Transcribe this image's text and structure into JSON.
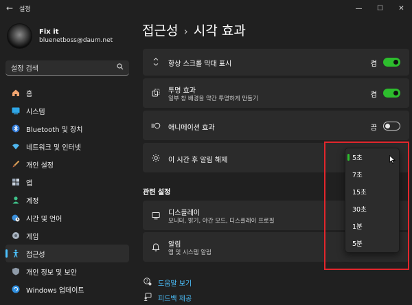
{
  "window": {
    "title": "설정"
  },
  "profile": {
    "name": "Fix it",
    "email": "bluenetboss@daum.net"
  },
  "search": {
    "placeholder": "설정 검색"
  },
  "nav": [
    {
      "label": "홈",
      "icon": "home-icon"
    },
    {
      "label": "시스템",
      "icon": "system-icon"
    },
    {
      "label": "Bluetooth 및 장치",
      "icon": "bluetooth-icon"
    },
    {
      "label": "네트워크 및 인터넷",
      "icon": "wifi-icon"
    },
    {
      "label": "개인 설정",
      "icon": "brush-icon"
    },
    {
      "label": "앱",
      "icon": "apps-icon"
    },
    {
      "label": "계정",
      "icon": "account-icon"
    },
    {
      "label": "시간 및 언어",
      "icon": "globe-clock-icon"
    },
    {
      "label": "게임",
      "icon": "gamepad-icon"
    },
    {
      "label": "접근성",
      "icon": "accessibility-icon",
      "active": true
    },
    {
      "label": "개인 정보 및 보안",
      "icon": "shield-icon"
    },
    {
      "label": "Windows 업데이트",
      "icon": "update-icon"
    }
  ],
  "page": {
    "parent": "접근성",
    "current": "시각 효과"
  },
  "settings": {
    "scrollbars": {
      "title": "항상 스크롤 막대 표시",
      "state": "켬",
      "on": true
    },
    "transparency": {
      "title": "투명 효과",
      "subtitle": "일부 창 배경을 약간 투명하게 만들기",
      "state": "켬",
      "on": true
    },
    "animation": {
      "title": "애니메이션 효과",
      "state": "끔",
      "on": false
    },
    "dismiss": {
      "title": "이 시간 후 알림 해제"
    }
  },
  "related": {
    "heading": "관련 설정",
    "display": {
      "title": "디스플레이",
      "subtitle": "모니터, 밝기, 야간 모드, 디스플레이 프로필"
    },
    "notifications": {
      "title": "알림",
      "subtitle": "앱 및 시스템 알림"
    }
  },
  "dropdown": {
    "options": [
      "5초",
      "7초",
      "15초",
      "30초",
      "1분",
      "5분"
    ],
    "selected": "5초"
  },
  "links": {
    "help": "도움말 보기",
    "feedback": "피드백 제공"
  },
  "colors": {
    "accent": "#4cc2ff",
    "toggle_on": "#2dbd2d",
    "highlight_box": "#e3262c",
    "background": "#202020",
    "card": "#2b2b2b"
  }
}
